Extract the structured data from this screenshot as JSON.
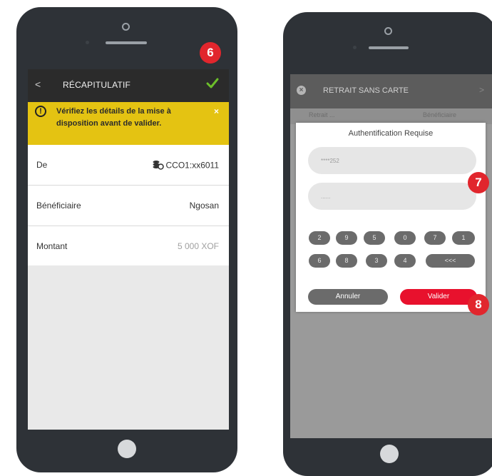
{
  "left_phone": {
    "header": {
      "back": "<",
      "title": "RÉCAPITULATIF",
      "confirm_icon": "check-icon"
    },
    "warning": {
      "text": "Vérifiez les détails de la mise à disposition avant de valider.",
      "close": "×"
    },
    "rows": [
      {
        "label": "De",
        "value": "CCO1:xx6011",
        "icon": "coins-icon"
      },
      {
        "label": "Bénéficiaire",
        "value": "Ngosan"
      },
      {
        "label": "Montant",
        "value": "5 000 XOF"
      }
    ],
    "step_badge": "6"
  },
  "right_phone": {
    "header": {
      "title": "RETRAIT SANS CARTE",
      "close": "×",
      "arrow": ">"
    },
    "subheader": {
      "left": "Retrait ...",
      "right": "Bénéficiaire"
    },
    "modal": {
      "title": "Authentification Requise",
      "field1": "****252",
      "field2": "......",
      "keys_row1": [
        "2",
        "9",
        "5",
        "0",
        "7",
        "1"
      ],
      "keys_row2": [
        "6",
        "8",
        "3",
        "4",
        "<<<"
      ],
      "cancel_label": "Annuler",
      "validate_label": "Valider"
    },
    "step_badges": [
      "7",
      "8"
    ]
  },
  "colors": {
    "accent_red": "#e1262d",
    "warning_yellow": "#e4c312",
    "check_green": "#6cbf2a"
  }
}
